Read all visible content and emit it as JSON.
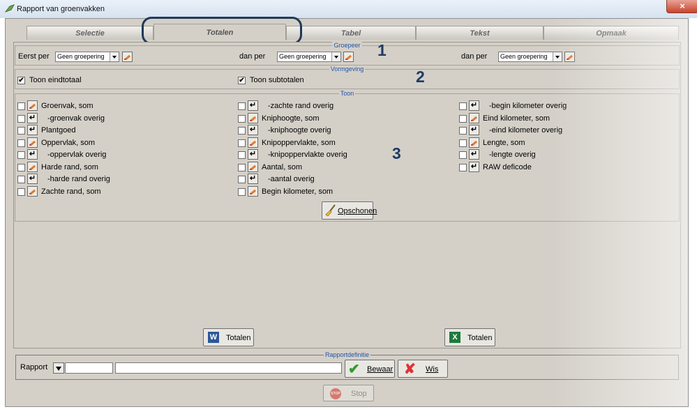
{
  "window": {
    "title": "Rapport van groenvakken",
    "close_glyph": "×"
  },
  "tabs": [
    {
      "label": "Selectie",
      "active": false
    },
    {
      "label": "Totalen",
      "active": true
    },
    {
      "label": "Tabel",
      "active": false
    },
    {
      "label": "Tekst",
      "active": false
    },
    {
      "label": "Opmaak",
      "active": false
    }
  ],
  "groepeer": {
    "title": "Groepeer",
    "eerst_label": "Eerst per",
    "dan_label_1": "dan per",
    "dan_label_2": "dan per",
    "combo_1": "Geen groepering",
    "combo_2": "Geen groepering",
    "combo_3": "Geen groepering"
  },
  "vormgeving": {
    "title": "Vormgeving",
    "eindtotaal": {
      "label": "Toon eindtotaal",
      "checked": "✔"
    },
    "subtotalen": {
      "label": "Toon subtotalen",
      "checked": "✔"
    }
  },
  "toon": {
    "title": "Toon",
    "col1": [
      {
        "label": "Groenvak, som",
        "icon": "pencil-icon"
      },
      {
        "label": "-groenvak overig",
        "icon": "enter-icon"
      },
      {
        "label": "Plantgoed",
        "icon": "enter-icon"
      },
      {
        "label": "Oppervlak, som",
        "icon": "pencil-icon"
      },
      {
        "label": "-oppervlak overig",
        "icon": "enter-icon"
      },
      {
        "label": "Harde rand, som",
        "icon": "pencil-icon"
      },
      {
        "label": "-harde rand overig",
        "icon": "enter-icon"
      },
      {
        "label": "Zachte rand, som",
        "icon": "pencil-icon"
      }
    ],
    "col2": [
      {
        "label": "-zachte rand overig",
        "icon": "enter-icon"
      },
      {
        "label": "Kniphoogte, som",
        "icon": "pencil-icon"
      },
      {
        "label": "-kniphoogte overig",
        "icon": "enter-icon"
      },
      {
        "label": "Knipoppervlakte, som",
        "icon": "pencil-icon"
      },
      {
        "label": "-knipoppervlakte overig",
        "icon": "enter-icon"
      },
      {
        "label": "Aantal, som",
        "icon": "pencil-icon"
      },
      {
        "label": "-aantal overig",
        "icon": "enter-icon"
      },
      {
        "label": "Begin kilometer, som",
        "icon": "pencil-icon"
      }
    ],
    "col3": [
      {
        "label": "-begin kilometer overig",
        "icon": "enter-icon"
      },
      {
        "label": "Eind kilometer, som",
        "icon": "pencil-icon"
      },
      {
        "label": "-eind kilometer overig",
        "icon": "enter-icon"
      },
      {
        "label": "Lengte, som",
        "icon": "pencil-icon"
      },
      {
        "label": "-lengte overig",
        "icon": "enter-icon"
      },
      {
        "label": "RAW deficode",
        "icon": "enter-icon"
      }
    ],
    "opschonen": "Opschonen"
  },
  "annotations": {
    "n1": "1",
    "n2": "2",
    "n3": "3"
  },
  "export": {
    "word_label": "Totalen",
    "excel_label": "Totalen",
    "word_letter": "W",
    "excel_letter": "X"
  },
  "rapportdefinitie": {
    "title": "Rapportdefinitie",
    "label": "Rapport",
    "field_short": "",
    "field_long": "",
    "bewaar": "Bewaar",
    "wis": "Wis"
  },
  "stop": {
    "label": "Stop",
    "badge": "STOP"
  },
  "colors": {
    "accent": "#2453a6",
    "annotation": "#1f3b64",
    "panel": "#d4d0c8"
  }
}
